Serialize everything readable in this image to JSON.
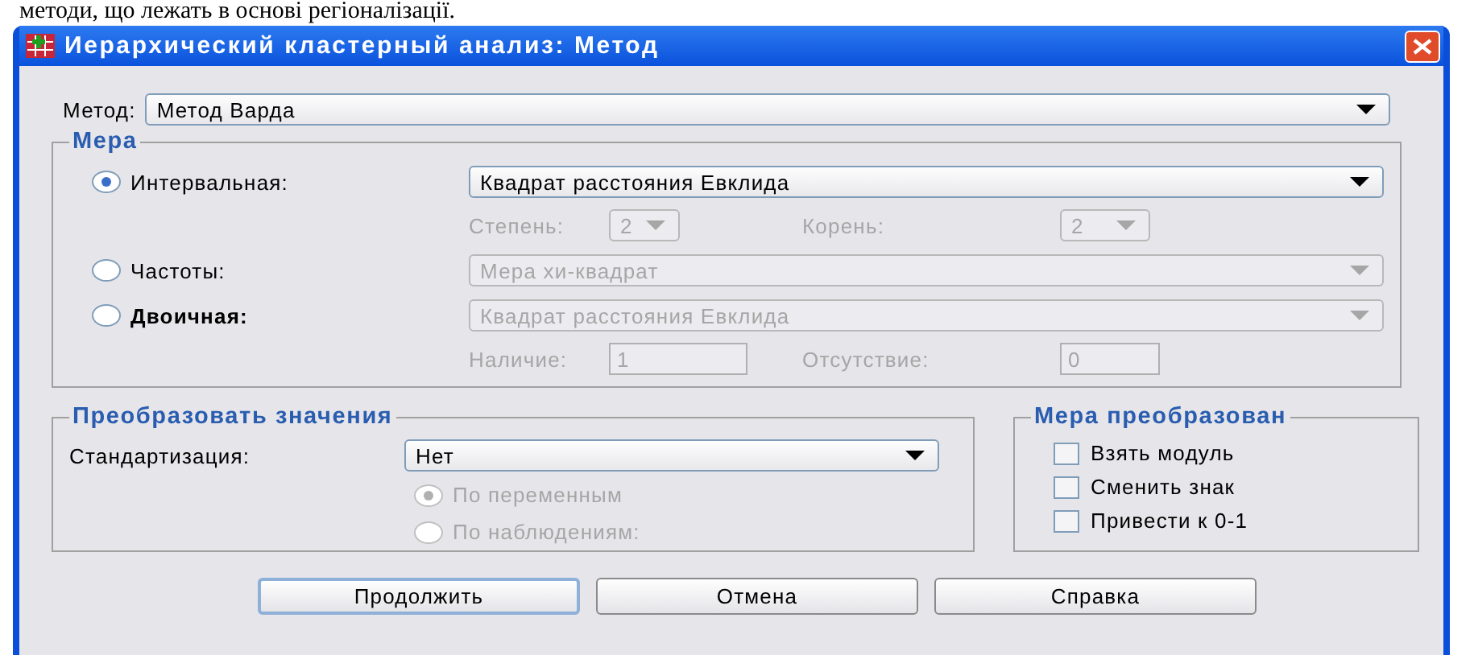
{
  "page_text": "методи, що лежать в основі регіоналізації.",
  "window": {
    "title": "Иерархический кластерный анализ: Метод"
  },
  "method": {
    "label": "Метод:",
    "value": "Метод Варда"
  },
  "measure": {
    "title": "Мера",
    "options": [
      {
        "label": "Интервальная:",
        "selected": true,
        "value": "Квадрат расстояния Евклида",
        "disabled": false
      },
      {
        "label": "Частоты:",
        "selected": false,
        "value": "Мера хи-квадрат",
        "disabled": true
      },
      {
        "label": "Двоичная:",
        "selected": false,
        "value": "Квадрат расстояния Евклида",
        "disabled": true
      }
    ],
    "power": {
      "label": "Степень:",
      "value": "2",
      "disabled": true
    },
    "root": {
      "label": "Корень:",
      "value": "2",
      "disabled": true
    },
    "present": {
      "label": "Наличие:",
      "value": "1",
      "disabled": true
    },
    "absent": {
      "label": "Отсутствие:",
      "value": "0",
      "disabled": true
    }
  },
  "transform_values": {
    "title": "Преобразовать значения",
    "standardize": {
      "label": "Стандартизация:",
      "value": "Нет"
    },
    "scope": [
      {
        "label": "По переменным",
        "selected": true,
        "disabled": true
      },
      {
        "label": "По наблюдениям:",
        "selected": false,
        "disabled": true
      }
    ]
  },
  "transform_measure": {
    "title": "Мера преобразован",
    "options": [
      {
        "label": "Взять модуль",
        "checked": false
      },
      {
        "label": "Сменить знак",
        "checked": false
      },
      {
        "label": "Привести к 0-1",
        "checked": false
      }
    ]
  },
  "buttons": [
    {
      "label": "Продолжить",
      "default": true
    },
    {
      "label": "Отмена",
      "default": false
    },
    {
      "label": "Справка",
      "default": false
    }
  ]
}
